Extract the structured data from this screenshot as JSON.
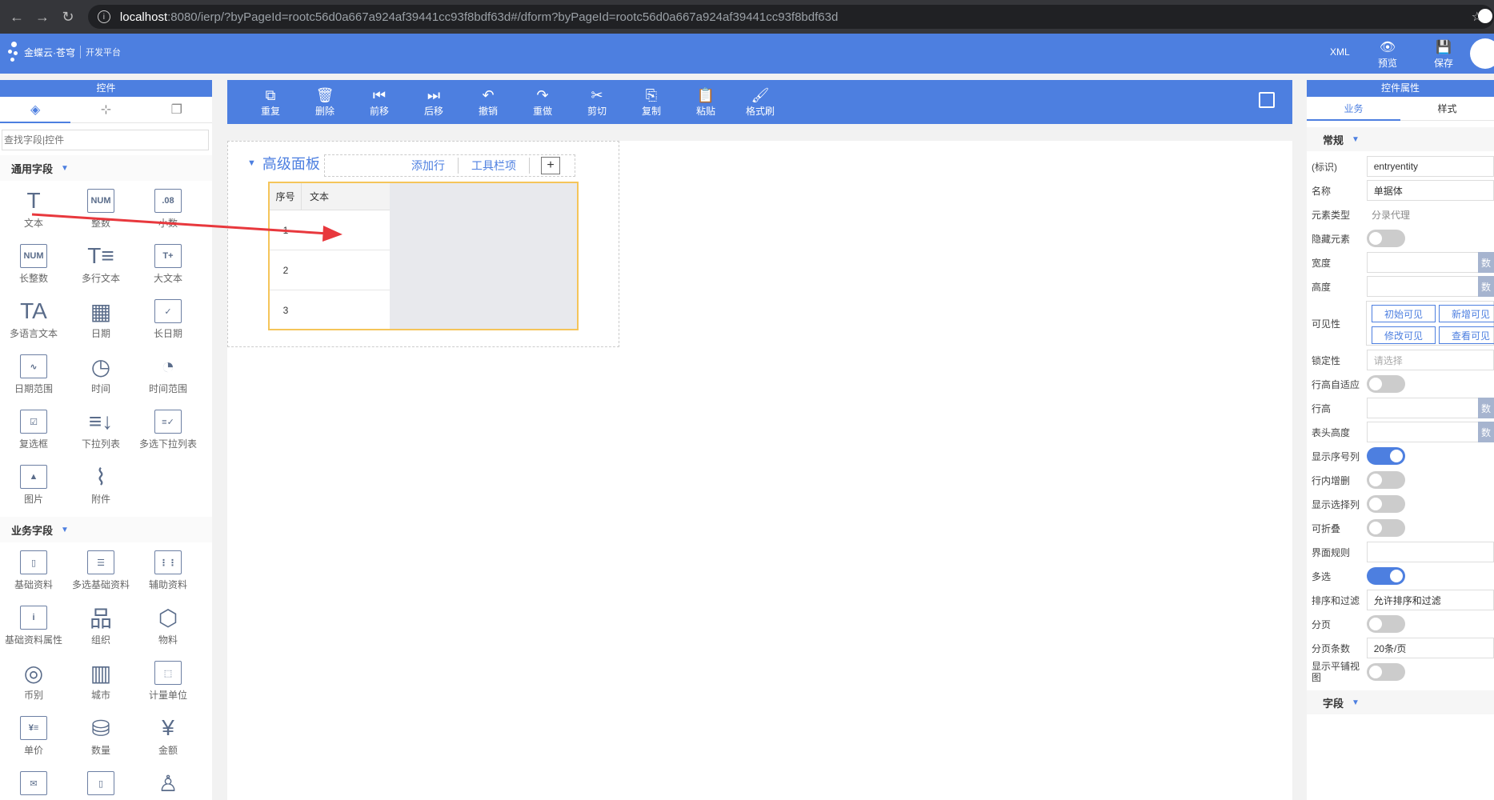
{
  "browser": {
    "url_host": "localhost",
    "url_rest": ":8080/ierp/?byPageId=rootc56d0a667a924af39441cc93f8bdf63d#/dform?byPageId=rootc56d0a667a924af39441cc93f8bdf63d"
  },
  "header": {
    "logo_text": "金蝶云·苍穹",
    "logo_sub": "开发平台",
    "xml_label": "XML",
    "preview_label": "预览",
    "save_label": "保存",
    "accent_color": "#4d7fe0"
  },
  "left_panel": {
    "title": "控件",
    "search_placeholder": "查找字段|控件",
    "common_section": "通用字段",
    "common_items": [
      {
        "label": "文本",
        "glyph": "T"
      },
      {
        "label": "整数",
        "glyph": "NUM"
      },
      {
        "label": "小数",
        "glyph": ".08"
      },
      {
        "label": "长整数",
        "glyph": "NUM"
      },
      {
        "label": "多行文本",
        "glyph": "T≡"
      },
      {
        "label": "大文本",
        "glyph": "T+"
      },
      {
        "label": "多语言文本",
        "glyph": "TA"
      },
      {
        "label": "日期",
        "glyph": "▦"
      },
      {
        "label": "长日期",
        "glyph": "✓"
      },
      {
        "label": "日期范围",
        "glyph": "∿"
      },
      {
        "label": "时间",
        "glyph": "◷"
      },
      {
        "label": "时间范围",
        "glyph": "◔"
      },
      {
        "label": "复选框",
        "glyph": "☑"
      },
      {
        "label": "下拉列表",
        "glyph": "≡↓"
      },
      {
        "label": "多选下拉列表",
        "glyph": "≡✓"
      },
      {
        "label": "图片",
        "glyph": "▲"
      },
      {
        "label": "附件",
        "glyph": "⌇"
      }
    ],
    "business_section": "业务字段",
    "business_items": [
      {
        "label": "基础资料",
        "glyph": "▯"
      },
      {
        "label": "多选基础资料",
        "glyph": "☰"
      },
      {
        "label": "辅助资料",
        "glyph": "⋮⋮"
      },
      {
        "label": "基础资料属性",
        "glyph": "i"
      },
      {
        "label": "组织",
        "glyph": "品"
      },
      {
        "label": "物料",
        "glyph": "⬡"
      },
      {
        "label": "币别",
        "glyph": "◎"
      },
      {
        "label": "城市",
        "glyph": "▥"
      },
      {
        "label": "计量单位",
        "glyph": "⬚"
      },
      {
        "label": "单价",
        "glyph": "¥≡"
      },
      {
        "label": "数量",
        "glyph": "⛁"
      },
      {
        "label": "金额",
        "glyph": "¥"
      },
      {
        "label": "",
        "glyph": "✉"
      },
      {
        "label": "",
        "glyph": "▯"
      },
      {
        "label": "",
        "glyph": "♙"
      }
    ]
  },
  "toolbar": {
    "buttons": [
      {
        "label": "重复",
        "glyph": "⧉"
      },
      {
        "label": "删除",
        "glyph": "🗑"
      },
      {
        "label": "前移",
        "glyph": "⏮"
      },
      {
        "label": "后移",
        "glyph": "⏭"
      },
      {
        "label": "撤销",
        "glyph": "↶"
      },
      {
        "label": "重做",
        "glyph": "↷"
      },
      {
        "label": "剪切",
        "glyph": "✂"
      },
      {
        "label": "复制",
        "glyph": "⎘"
      },
      {
        "label": "粘贴",
        "glyph": "📋"
      },
      {
        "label": "格式刷",
        "glyph": "🖌"
      }
    ]
  },
  "canvas": {
    "panel_title": "高级面板",
    "add_row": "添加行",
    "toolbar_item": "工具栏项",
    "plus": "+",
    "grid_headers": [
      "序号",
      "文本"
    ],
    "grid_rows": [
      "1",
      "2",
      "3"
    ]
  },
  "right_panel": {
    "title": "控件属性",
    "tab_business": "业务",
    "tab_style": "样式",
    "group_general": "常规",
    "group_field": "字段",
    "props": {
      "id_label": "(标识)",
      "id_value": "entryentity",
      "name_label": "名称",
      "name_value": "单据体",
      "type_label": "元素类型",
      "type_value": "分录代理",
      "hide_label": "隐藏元素",
      "width_label": "宽度",
      "height_label": "高度",
      "visibility_label": "可见性",
      "vis_buttons": [
        "初始可见",
        "新增可见",
        "修改可见",
        "查看可见"
      ],
      "lock_label": "锁定性",
      "lock_placeholder": "请选择",
      "autorow_label": "行高自适应",
      "rowheight_label": "行高",
      "headheight_label": "表头高度",
      "showseq_label": "显示序号列",
      "inline_label": "行内增删",
      "showsel_label": "显示选择列",
      "fold_label": "可折叠",
      "rule_label": "界面规则",
      "multi_label": "多选",
      "sort_label": "排序和过滤",
      "sort_value": "允许排序和过滤",
      "page_label": "分页",
      "pagesize_label": "分页条数",
      "pagesize_value": "20条/页",
      "tile_label": "显示平铺视图"
    }
  }
}
